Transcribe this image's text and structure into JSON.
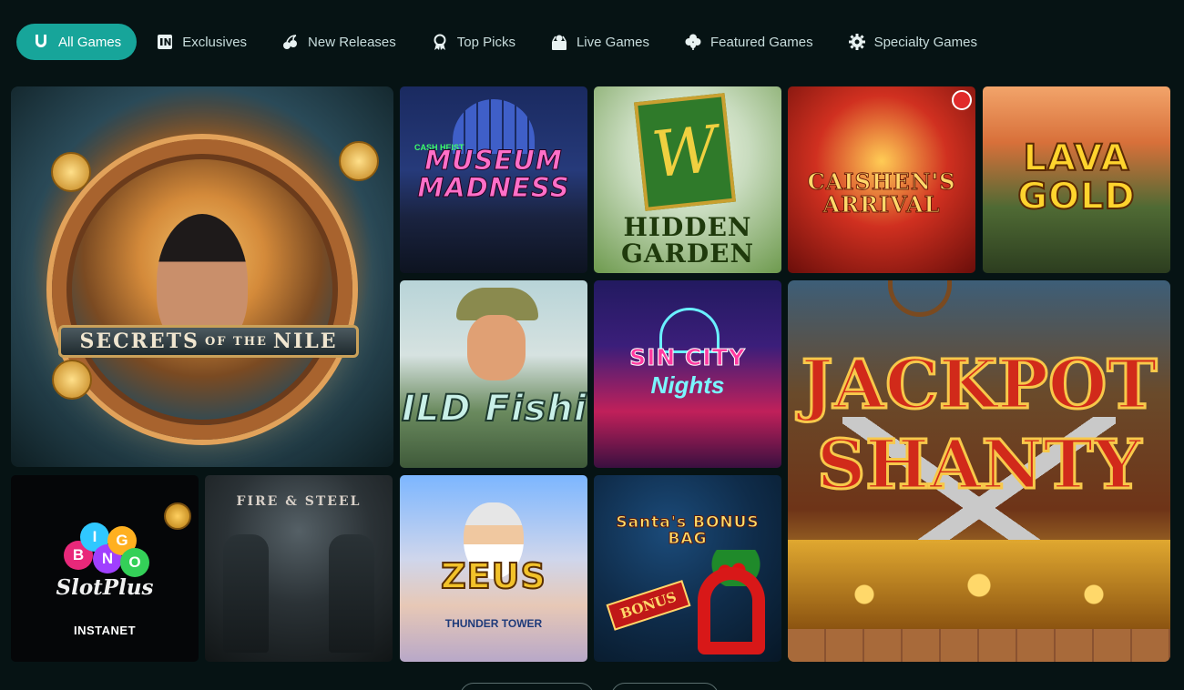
{
  "nav": {
    "tabs": [
      {
        "label": "All Games",
        "icon": "horseshoe-icon",
        "active": true
      },
      {
        "label": "Exclusives",
        "icon": "in-badge-icon"
      },
      {
        "label": "New Releases",
        "icon": "cherries-icon"
      },
      {
        "label": "Top Picks",
        "icon": "award-ribbon-icon"
      },
      {
        "label": "Live Games",
        "icon": "dealer-icon"
      },
      {
        "label": "Featured Games",
        "icon": "clover-icon"
      },
      {
        "label": "Specialty Games",
        "icon": "gear-icon"
      }
    ]
  },
  "games": {
    "nile": {
      "title_main": "SECRETS",
      "title_of": "OF THE",
      "title_end": "NILE"
    },
    "museum": {
      "kicker": "CASH HEIST",
      "title": "MUSEUM MADNESS"
    },
    "garden": {
      "title": "HIDDEN GARDEN"
    },
    "caishen": {
      "title": "CAISHEN'S ARRIVAL"
    },
    "lava": {
      "title": "LAVA GOLD"
    },
    "fishing": {
      "title": "ILD Fishi"
    },
    "sincity": {
      "title": "SIN CITY",
      "subtitle": "Nights"
    },
    "jackpot": {
      "line1": "JACKPOT",
      "line2": "SHANTY"
    },
    "bingo": {
      "balls": [
        "B",
        "I",
        "N",
        "G",
        "O"
      ],
      "script": "SlotPlus",
      "provider": "INSTANET"
    },
    "fire": {
      "title": "FIRE & STEEL"
    },
    "zeus": {
      "title": "ZEUS",
      "subtitle": "THUNDER TOWER"
    },
    "santa": {
      "title": "Santa's BONUS BAG",
      "bonus_tag": "BONUS"
    }
  },
  "colors": {
    "accent": "#17a59a",
    "background": "#061314"
  }
}
